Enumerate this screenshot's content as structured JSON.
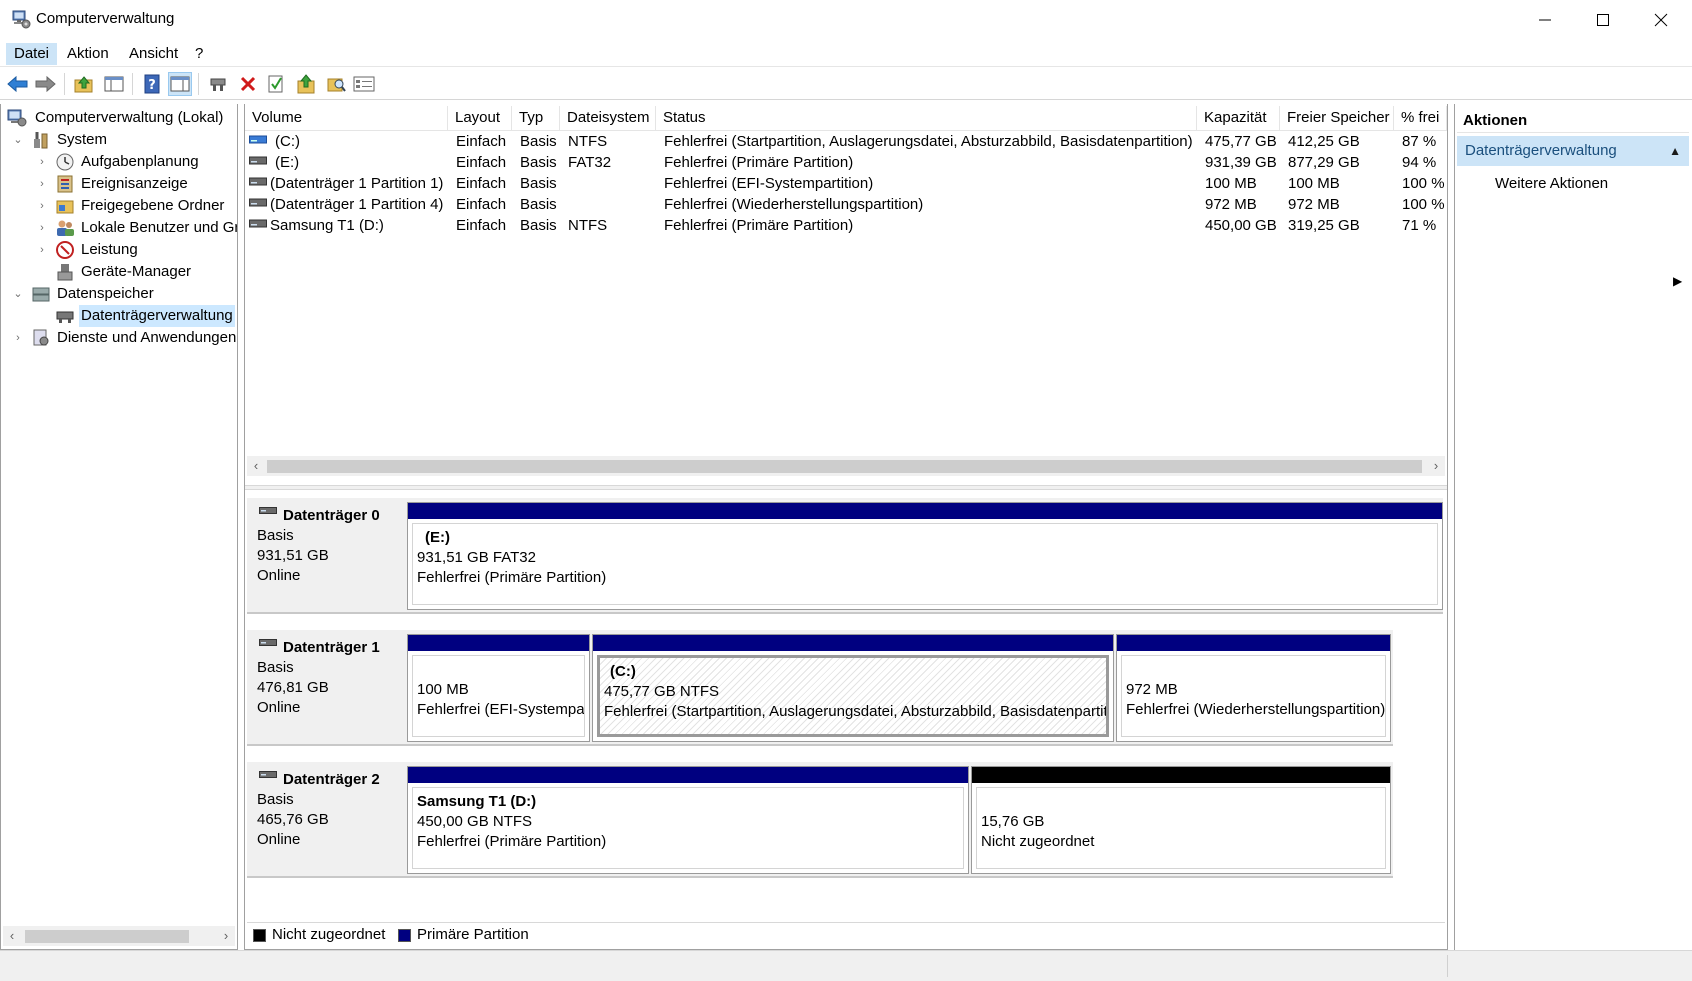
{
  "window": {
    "title": "Computerverwaltung",
    "app_icon": "computer-management-icon",
    "controls": [
      "minimize-icon",
      "maximize-icon",
      "close-icon"
    ]
  },
  "menu": {
    "items": [
      "Datei",
      "Aktion",
      "Ansicht",
      "?"
    ]
  },
  "toolbar": {
    "buttons": [
      "back-arrow-icon",
      "forward-arrow-icon",
      "up-folder-icon",
      "console-tree-icon",
      "help-icon",
      "mmc-view-icon",
      "connect-icon",
      "delete-icon",
      "checklist-icon",
      "folder-up-icon",
      "search-folder-icon",
      "properties-icon"
    ]
  },
  "tree": {
    "root": "Computerverwaltung (Lokal)",
    "system": "System",
    "aufgabenplanung": "Aufgabenplanung",
    "ereignisanzeige": "Ereignisanzeige",
    "freigegebene": "Freigegebene Ordner",
    "lokale": "Lokale Benutzer und Gruppen",
    "leistung": "Leistung",
    "geraete": "Geräte-Manager",
    "datenspeicher": "Datenspeicher",
    "datentraeger": "Datenträgerverwaltung",
    "dienste": "Dienste und Anwendungen"
  },
  "volumes": {
    "headers": [
      "Volume",
      "Layout",
      "Typ",
      "Dateisystem",
      "Status",
      "Kapazität",
      "Freier Speicher",
      "% frei"
    ],
    "rows": [
      {
        "volume": "(C:)",
        "layout": "Einfach",
        "typ": "Basis",
        "fs": "NTFS",
        "status": "Fehlerfrei (Startpartition, Auslagerungsdatei, Absturzabbild, Basisdatenpartition)",
        "cap": "475,77 GB",
        "free": "412,25 GB",
        "pct": "87 %"
      },
      {
        "volume": "(E:)",
        "layout": "Einfach",
        "typ": "Basis",
        "fs": "FAT32",
        "status": "Fehlerfrei (Primäre Partition)",
        "cap": "931,39 GB",
        "free": "877,29 GB",
        "pct": "94 %"
      },
      {
        "volume": "(Datenträger 1 Partition 1)",
        "layout": "Einfach",
        "typ": "Basis",
        "fs": "",
        "status": "Fehlerfrei (EFI-Systempartition)",
        "cap": "100 MB",
        "free": "100 MB",
        "pct": "100 %"
      },
      {
        "volume": "(Datenträger 1 Partition 4)",
        "layout": "Einfach",
        "typ": "Basis",
        "fs": "",
        "status": "Fehlerfrei (Wiederherstellungspartition)",
        "cap": "972 MB",
        "free": "972 MB",
        "pct": "100 %"
      },
      {
        "volume": "Samsung T1 (D:)",
        "layout": "Einfach",
        "typ": "Basis",
        "fs": "NTFS",
        "status": "Fehlerfrei (Primäre Partition)",
        "cap": "450,00 GB",
        "free": "319,25 GB",
        "pct": "71 %"
      }
    ]
  },
  "disks": [
    {
      "name": "Datenträger 0",
      "type": "Basis",
      "size": "931,51 GB",
      "state": "Online",
      "partitions": [
        {
          "label": "(E:)",
          "line1": "931,51 GB FAT32",
          "line2": "Fehlerfrei (Primäre Partition)"
        }
      ]
    },
    {
      "name": "Datenträger 1",
      "type": "Basis",
      "size": "476,81 GB",
      "state": "Online",
      "partitions": [
        {
          "label": "",
          "line1": "100 MB",
          "line2": "Fehlerfrei (EFI-Systempartition)"
        },
        {
          "label": "(C:)",
          "line1": "475,77 GB NTFS",
          "line2": "Fehlerfrei (Startpartition, Auslagerungsdatei, Absturzabbild, Basisdatenpartition)"
        },
        {
          "label": "",
          "line1": "972 MB",
          "line2": "Fehlerfrei (Wiederherstellungspartition)"
        }
      ]
    },
    {
      "name": "Datenträger 2",
      "type": "Basis",
      "size": "465,76 GB",
      "state": "Online",
      "partitions": [
        {
          "label": "Samsung T1  (D:)",
          "line1": "450,00 GB NTFS",
          "line2": "Fehlerfrei (Primäre Partition)"
        },
        {
          "label": "",
          "line1": "15,76 GB",
          "line2": "Nicht zugeordnet"
        }
      ]
    }
  ],
  "legend": {
    "unallocated": "Nicht zugeordnet",
    "primary": "Primäre Partition",
    "unallocated_color": "#000000",
    "primary_color": "#000080"
  },
  "actions": {
    "header": "Aktionen",
    "group": "Datenträgerverwaltung",
    "more": "Weitere Aktionen"
  },
  "colors": {
    "primary_partition": "#000080",
    "unallocated": "#000000",
    "selection": "#cce8ff",
    "action_group": "#cce4f7"
  }
}
